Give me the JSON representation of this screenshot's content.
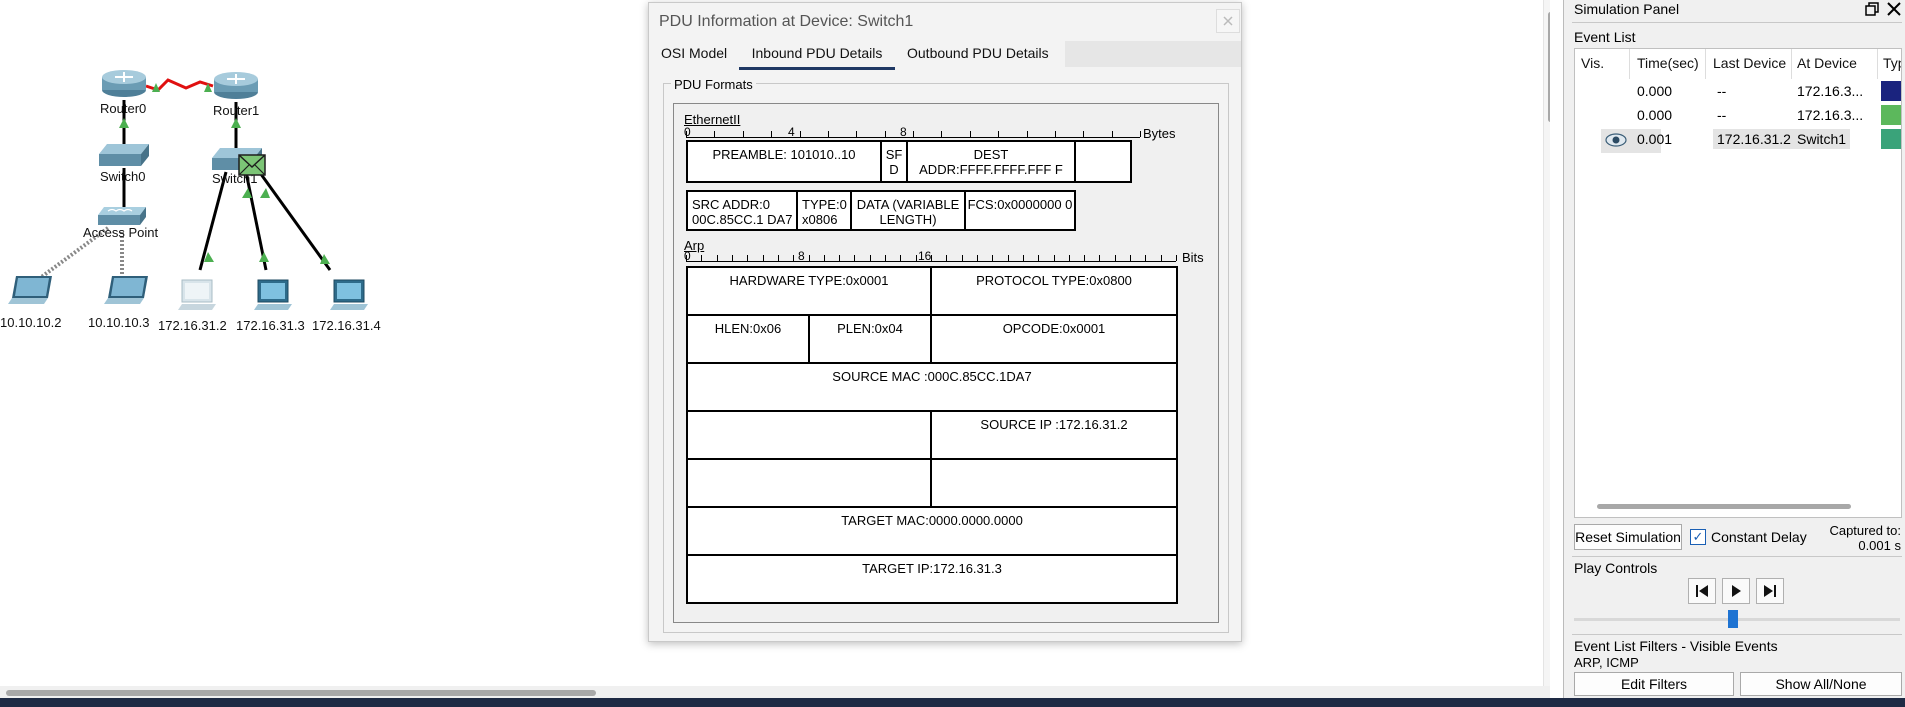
{
  "topology": {
    "devices": [
      {
        "name": "Router0"
      },
      {
        "name": "Router1"
      },
      {
        "name": "Switch0"
      },
      {
        "name": "Switch1"
      },
      {
        "name": "Access Point"
      },
      {
        "name": "10.10.10.2"
      },
      {
        "name": "10.10.10.3"
      },
      {
        "name": "172.16.31.2"
      },
      {
        "name": "172.16.31.3"
      },
      {
        "name": "172.16.31.4"
      }
    ]
  },
  "pdu_dialog": {
    "title": "PDU Information at Device: Switch1",
    "tabs": [
      {
        "label": "OSI Model",
        "active": false
      },
      {
        "label": "Inbound PDU Details",
        "active": true
      },
      {
        "label": "Outbound PDU Details",
        "active": false
      }
    ],
    "formats_label": "PDU Formats",
    "ethernet": {
      "label": "EthernetII",
      "ruler_numbers": [
        "0",
        "4",
        "8"
      ],
      "unit": "Bytes",
      "fields": {
        "preamble": "PREAMBLE: 101010..10",
        "sfd": "SF D",
        "dest_addr": "DEST ADDR:FFFF.FFFF.FFF F",
        "src_addr": "SRC ADDR:0 00C.85CC.1 DA7",
        "type": "TYPE:0 x0806",
        "data": "DATA (VARIABLE LENGTH)",
        "fcs": "FCS:0x0000000 0"
      }
    },
    "arp": {
      "label": "Arp",
      "ruler_numbers": [
        "0",
        "8",
        "16"
      ],
      "unit": "Bits",
      "fields": {
        "hardware_type": "HARDWARE TYPE:0x0001",
        "protocol_type": "PROTOCOL TYPE:0x0800",
        "hlen": "HLEN:0x06",
        "plen": "PLEN:0x04",
        "opcode": "OPCODE:0x0001",
        "source_mac": "SOURCE MAC :000C.85CC.1DA7",
        "source_ip": "SOURCE IP :172.16.31.2",
        "target_mac": "TARGET MAC:0000.0000.0000",
        "target_ip": "TARGET IP:172.16.31.3"
      }
    }
  },
  "sim_panel": {
    "title": "Simulation Panel",
    "event_list_label": "Event List",
    "columns": [
      "Vis.",
      "Time(sec)",
      "Last Device",
      "At Device",
      "Typ"
    ],
    "events": [
      {
        "vis": "",
        "time": "0.000",
        "last": "--",
        "at": "172.16.3...",
        "color": "#1a237e"
      },
      {
        "vis": "",
        "time": "0.000",
        "last": "--",
        "at": "172.16.3...",
        "color": "#5cb85c"
      },
      {
        "vis": "eye-icon",
        "time": "0.001",
        "last": "172.16.31.2",
        "at": "Switch1",
        "color": "#3aa37a"
      }
    ],
    "reset_label": "Reset Simulation",
    "constant_delay_label": "Constant Delay",
    "constant_delay_checked": true,
    "captured_label": "Captured to:",
    "captured_value": "0.001 s",
    "play_controls_label": "Play Controls",
    "filters_label": "Event List Filters - Visible Events",
    "filters_value": "ARP, ICMP",
    "edit_filters_label": "Edit Filters",
    "show_all_label": "Show All/None"
  }
}
